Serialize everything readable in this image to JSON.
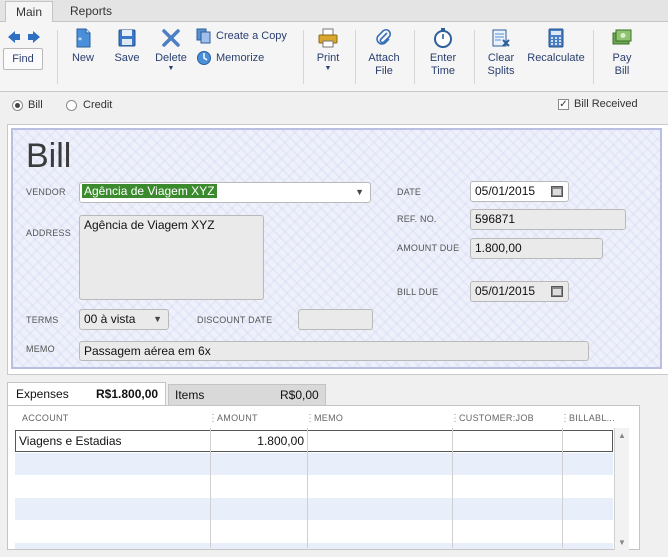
{
  "menu_tabs": [
    "Main",
    "Reports"
  ],
  "toolbar": {
    "find": "Find",
    "new": "New",
    "save": "Save",
    "delete": "Delete",
    "create_copy": "Create a Copy",
    "memorize": "Memorize",
    "print": "Print",
    "attach_file_1": "Attach",
    "attach_file_2": "File",
    "enter_time_1": "Enter",
    "enter_time_2": "Time",
    "clear_splits_1": "Clear",
    "clear_splits_2": "Splits",
    "recalculate": "Recalculate",
    "pay_bill_1": "Pay",
    "pay_bill_2": "Bill"
  },
  "mode": {
    "bill": "Bill",
    "credit": "Credit",
    "selected": "Bill",
    "bill_received": "Bill Received",
    "bill_received_checked": true
  },
  "form": {
    "title": "Bill",
    "vendor_label": "VENDOR",
    "vendor": "Agência de Viagem XYZ",
    "address_label": "ADDRESS",
    "address": "Agência de Viagem XYZ",
    "date_label": "DATE",
    "date": "05/01/2015",
    "ref_label": "REF. NO.",
    "ref_no": "596871",
    "amount_due_label": "AMOUNT DUE",
    "amount_due": "1.800,00",
    "bill_due_label": "BILL DUE",
    "bill_due": "05/01/2015",
    "terms_label": "TERMS",
    "terms": "00 à vista",
    "discount_date_label": "DISCOUNT DATE",
    "discount_date": "",
    "memo_label": "MEMO",
    "memo": "Passagem aérea em 6x"
  },
  "tabs": {
    "expenses_label": "Expenses",
    "expenses_total": "R$1.800,00",
    "items_label": "Items",
    "items_total": "R$0,00"
  },
  "grid": {
    "columns": [
      "ACCOUNT",
      "AMOUNT",
      "MEMO",
      "CUSTOMER:JOB",
      "BILLABL..."
    ],
    "rows": [
      {
        "account": "Viagens e Estadias",
        "amount": "1.800,00",
        "memo": "",
        "customer_job": "",
        "billable": ""
      }
    ]
  },
  "colors": {
    "accent": "#2a3f6f",
    "vendor_highlight": "#3c8a2e",
    "panel_bg": "#eef1fb",
    "panel_border": "#b8bfe0",
    "row_alt": "#e8eefa"
  }
}
